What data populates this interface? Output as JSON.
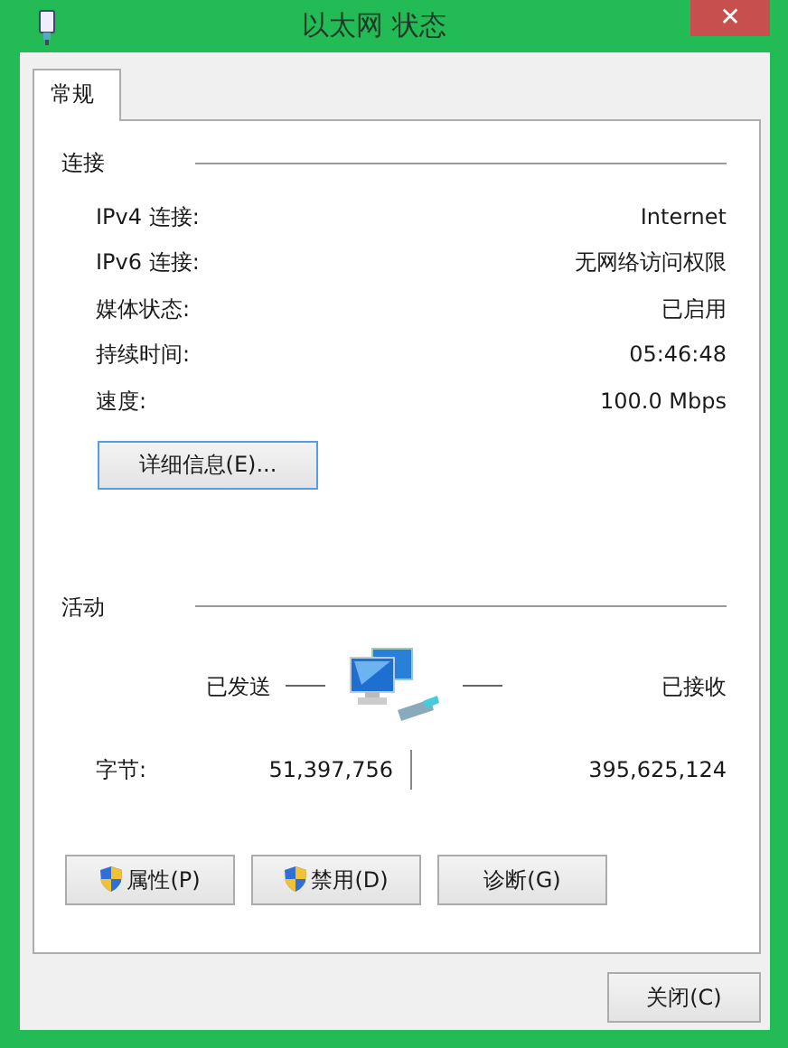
{
  "window": {
    "title": "以太网 状态",
    "close_symbol": "✕"
  },
  "tabs": [
    {
      "label": "常规",
      "selected": true
    }
  ],
  "connection": {
    "heading": "连接",
    "rows": [
      {
        "label": "IPv4 连接:",
        "value": "Internet"
      },
      {
        "label": "IPv6 连接:",
        "value": "无网络访问权限"
      },
      {
        "label": "媒体状态:",
        "value": "已启用"
      },
      {
        "label": "持续时间:",
        "value": "05:46:48"
      },
      {
        "label": "速度:",
        "value": "100.0 Mbps"
      }
    ],
    "details_button": "详细信息(E)..."
  },
  "activity": {
    "heading": "活动",
    "sent_label": "已发送",
    "received_label": "已接收",
    "bytes_label": "字节:",
    "bytes_sent": "51,397,756",
    "bytes_received": "395,625,124"
  },
  "buttons": [
    {
      "label": "属性(P)",
      "shield": true
    },
    {
      "label": "禁用(D)",
      "shield": true
    },
    {
      "label": "诊断(G)",
      "shield": false
    }
  ],
  "close_button": "关闭(C)"
}
